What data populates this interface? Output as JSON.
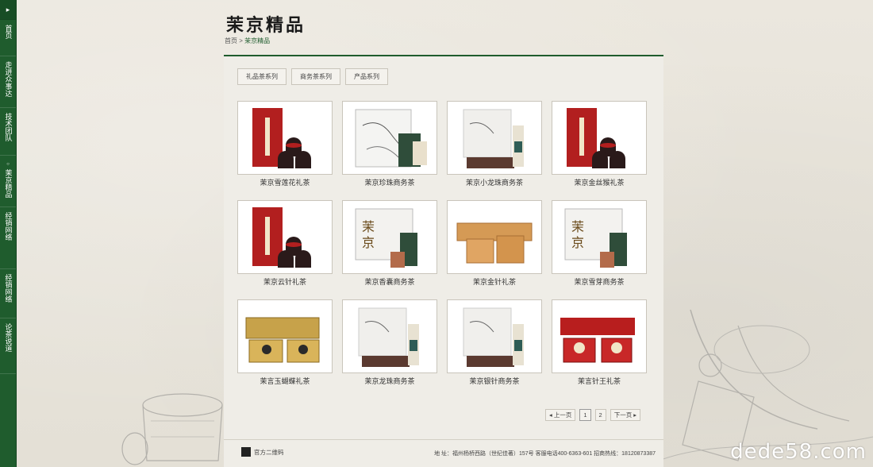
{
  "sidebar": {
    "items": [
      {
        "label": "首页"
      },
      {
        "label": "走进众事达"
      },
      {
        "label": "技术团队"
      },
      {
        "label": "茉京精品"
      },
      {
        "label": "经销网络"
      },
      {
        "label": "经销网络"
      },
      {
        "label": "论茶说道"
      }
    ]
  },
  "header": {
    "title": "茉京精品",
    "breadcrumb": {
      "home": "首页",
      "separator": ">",
      "current": "茉京精品"
    }
  },
  "tabs": [
    {
      "label": "礼品茶系列"
    },
    {
      "label": "商务茶系列"
    },
    {
      "label": "产品系列"
    }
  ],
  "products": [
    {
      "name": "茉京雪莲花礼茶",
      "image": "red-gift-box-with-tins"
    },
    {
      "name": "茉京珍珠商务茶",
      "image": "white-sketch-tin-box"
    },
    {
      "name": "茉京小龙珠商务茶",
      "image": "white-box-with-dark-base"
    },
    {
      "name": "茉京金丝猴礼茶",
      "image": "red-gift-box-with-tins"
    },
    {
      "name": "茉京云针礼茶",
      "image": "red-gift-box-with-tins"
    },
    {
      "name": "茉京香囊商务茶",
      "image": "white-tin-with-calligraphy"
    },
    {
      "name": "茉京金针礼茶",
      "image": "wooden-boxes"
    },
    {
      "name": "茉京雪芽商务茶",
      "image": "white-tin-with-calligraphy"
    },
    {
      "name": "茉言玉蝴蝶礼茶",
      "image": "gold-tray-box"
    },
    {
      "name": "茉京龙珠商务茶",
      "image": "white-box-with-dark-base"
    },
    {
      "name": "茉京银针商务茶",
      "image": "white-box-with-dark-base"
    },
    {
      "name": "茉言针王礼茶",
      "image": "red-tray-box"
    }
  ],
  "pagination": {
    "prev": "上一页",
    "pages": [
      "1",
      "2"
    ],
    "next": "下一页",
    "current": "1"
  },
  "footer": {
    "qr_label": "官方二维码",
    "address": "地  址：福州杨桥西路（世纪佳著）157号  客服电话400-6363-601  招商热线：18120873387"
  },
  "watermark": "dede58.com",
  "colors": {
    "accent": "#1f5c2d",
    "background": "#e9e5dc",
    "panel": "#efede7"
  }
}
